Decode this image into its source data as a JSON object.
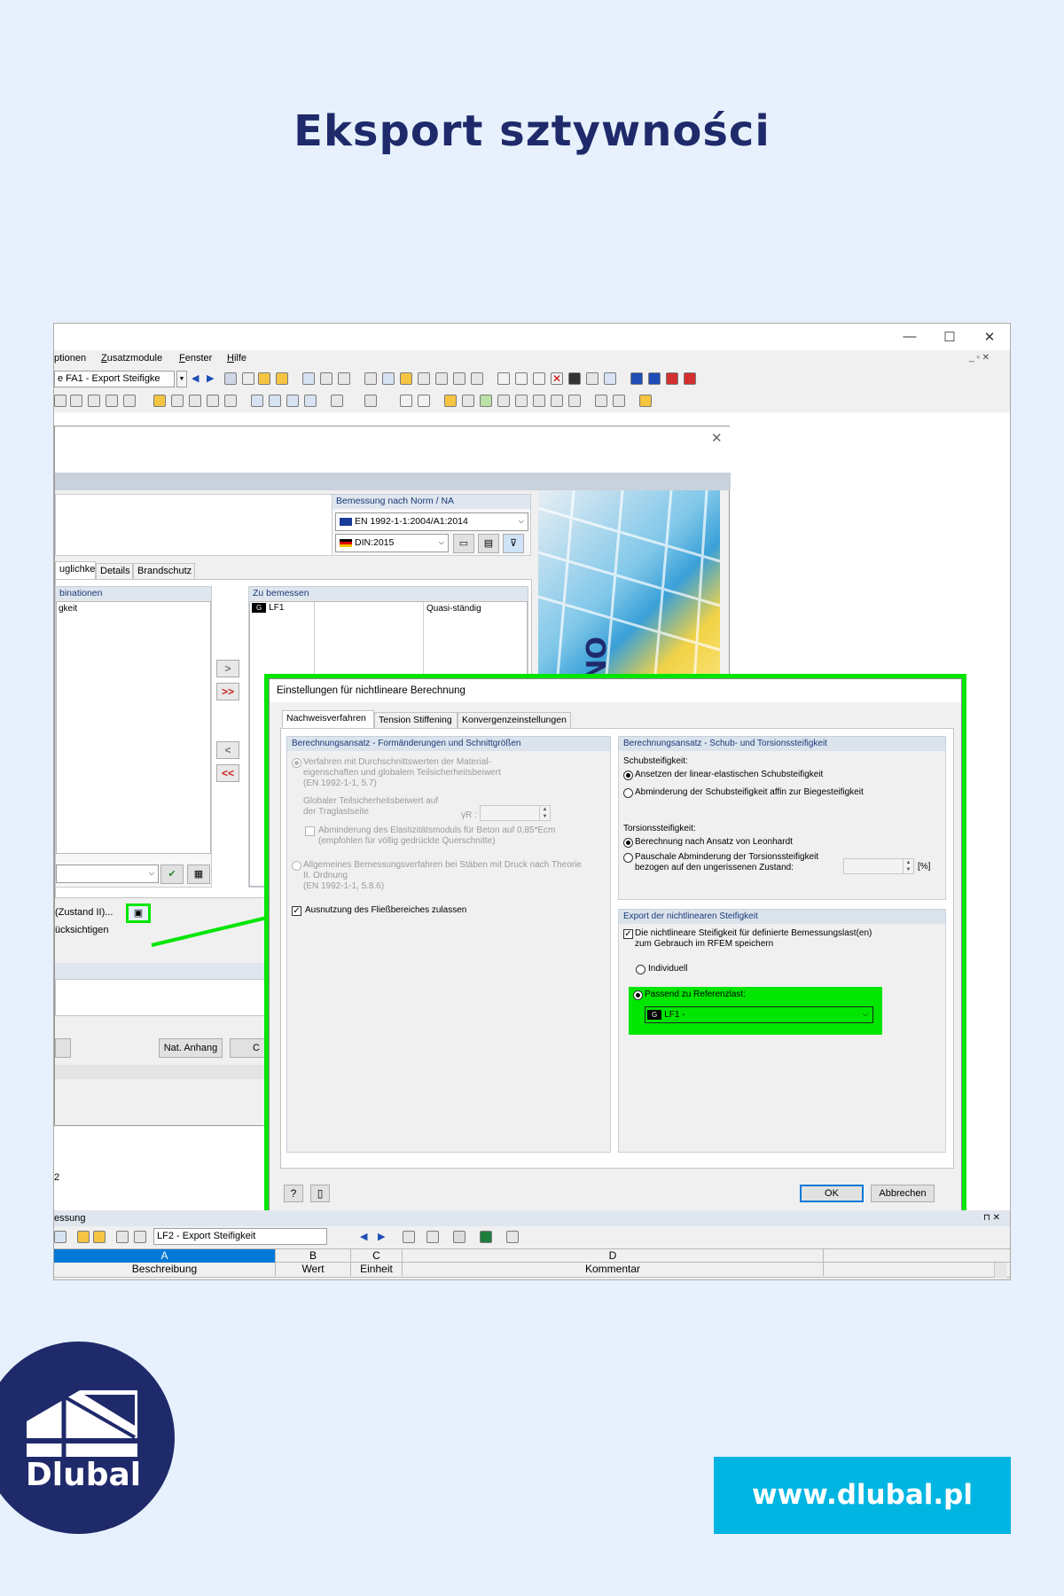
{
  "page_title": "Eksport sztywności",
  "window": {
    "min": "—",
    "max": "☐",
    "close": "✕",
    "mdi_controls": "_ ▫ ✕"
  },
  "menu": [
    "ptionen",
    "Zusatzmodule",
    "Fenster",
    "Hilfe"
  ],
  "menu_underline": [
    "",
    "Z",
    "F",
    "H"
  ],
  "menu_rest": [
    "ptionen",
    "usatzmodule",
    "enster",
    "ilfe"
  ],
  "toolbar": {
    "case_combo": "e FA1 - Export Steifigke"
  },
  "bg_dialog": {
    "close": "✕",
    "norm_header": "Bemessung nach Norm / NA",
    "norm_value": "EN 1992-1-1:2004/A1:2014",
    "na_value": "DIN:2015",
    "tabs": [
      "uglichkeit",
      "Details",
      "Brandschutz"
    ],
    "left_list_header": "binationen",
    "left_list_item": "gkeit",
    "right_list_header": "Zu bemessen",
    "right_list_badge": "G",
    "right_list_item": "LF1",
    "right_list_type": "Quasi-ständig",
    "arrow_right": ">",
    "arrow_right_all": ">>",
    "arrow_left": "<",
    "arrow_left_all": "<<",
    "option1": "(Zustand II)...",
    "option2": "ücksichtigen",
    "btn_nat_anhang": "Nat. Anhang",
    "btn_partial": "C",
    "status_num": "2"
  },
  "overlay": {
    "title": "Einstellungen für nichtlineare Berechnung",
    "tabs": [
      "Nachweisverfahren",
      "Tension Stiffening",
      "Konvergenzeinstellungen"
    ],
    "left_group": {
      "header": "Berechnungsansatz - Formänderungen und Schnittgrößen",
      "radio1_l1": "Verfahren mit Durchschnittswerten der Material-",
      "radio1_l2": "eigenschaften und globalem Teilsicherheitsbeiwert",
      "radio1_l3": "(EN 1992-1-1, 5.7)",
      "global_l1": "Globaler Teilsicherheitsbeiwert auf",
      "global_l2": "der Traglastseite",
      "gamma_label": "γR :",
      "chk_l1": "Abminderung des Elastizitätsmoduls für Beton auf 0,85*Ecm",
      "chk_l2": "(empfohlen für völlig gedrückte Querschnitte)",
      "radio2_l1": "Allgemeines Bemessungsverfahren bei Stäben mit Druck nach Theorie",
      "radio2_l2": "II. Ordnung",
      "radio2_l3": "(EN 1992-1-1, 5.8.6)",
      "yield_chk": "Ausnutzung des Fließbereiches zulassen"
    },
    "right_group": {
      "header": "Berechnungsansatz - Schub- und Torsionssteifigkeit",
      "shear_label": "Schubsteifigkeit:",
      "shear_opt1": "Ansetzen der linear-elastischen Schubsteifigkeit",
      "shear_opt2": "Abminderung der Schubsteifigkeit affin zur Biegesteifigkeit",
      "torsion_label": "Torsionssteifigkeit:",
      "torsion_opt1": "Berechnung nach Ansatz von Leonhardt",
      "torsion_opt2_l1": "Pauschale Abminderung der Torsionssteifigkeit",
      "torsion_opt2_l2": "bezogen auf den ungerissenen Zustand:",
      "unit": "[%]"
    },
    "export_group": {
      "header": "Export der nichtlinearen Steifigkeit",
      "chk_l1": "Die nichtlineare Steifigkeit für definierte Bemessungslast(en)",
      "chk_l2": "zum Gebrauch im RFEM speichern",
      "opt_individual": "Individuell",
      "opt_reference": "Passend zu Referenzlast:",
      "ref_badge": "G",
      "ref_value": "LF1 -"
    },
    "btn_ok": "OK",
    "btn_cancel": "Abbrechen"
  },
  "bottom": {
    "panel_title": "essung",
    "combo": "LF2 - Export Steifigkeit",
    "col_letters": [
      "A",
      "B",
      "C",
      "D"
    ],
    "col_headers": [
      "Beschreibung",
      "Wert",
      "Einheit",
      "Kommentar"
    ],
    "pin": "⊓ ✕"
  },
  "logo_text": "Dlubal",
  "url": "www.dlubal.pl"
}
